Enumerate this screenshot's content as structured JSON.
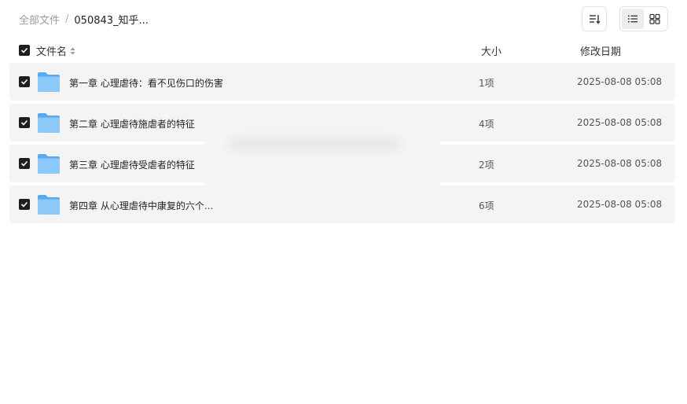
{
  "breadcrumb": {
    "root": "全部文件",
    "separator": "/",
    "current": "050843_知乎..."
  },
  "toolbar": {
    "sort_icon": "sort-icon",
    "list_view_icon": "list-view-icon",
    "grid_view_icon": "grid-view-icon",
    "active_view": "list"
  },
  "header": {
    "name": "文件名",
    "size": "大小",
    "date": "修改日期"
  },
  "files": [
    {
      "name": "第一章 心理虐待：看不见伤口的伤害",
      "size": "1项",
      "date": "2025-08-08 05:08",
      "checked": true
    },
    {
      "name": "第二章 心理虐待施虐者的特征",
      "size": "4项",
      "date": "2025-08-08 05:08",
      "checked": true
    },
    {
      "name": "第三章 心理虐待受虐者的特征",
      "size": "2项",
      "date": "2025-08-08 05:08",
      "checked": true
    },
    {
      "name": "第四章 从心理虐待中康复的六个...",
      "size": "6项",
      "date": "2025-08-08 05:08",
      "checked": true
    }
  ],
  "colors": {
    "row_bg": "#f4f4f4",
    "checkbox": "#1f1f1f",
    "folder_light": "#8cc8f8",
    "folder_dark": "#5aa8ee"
  }
}
